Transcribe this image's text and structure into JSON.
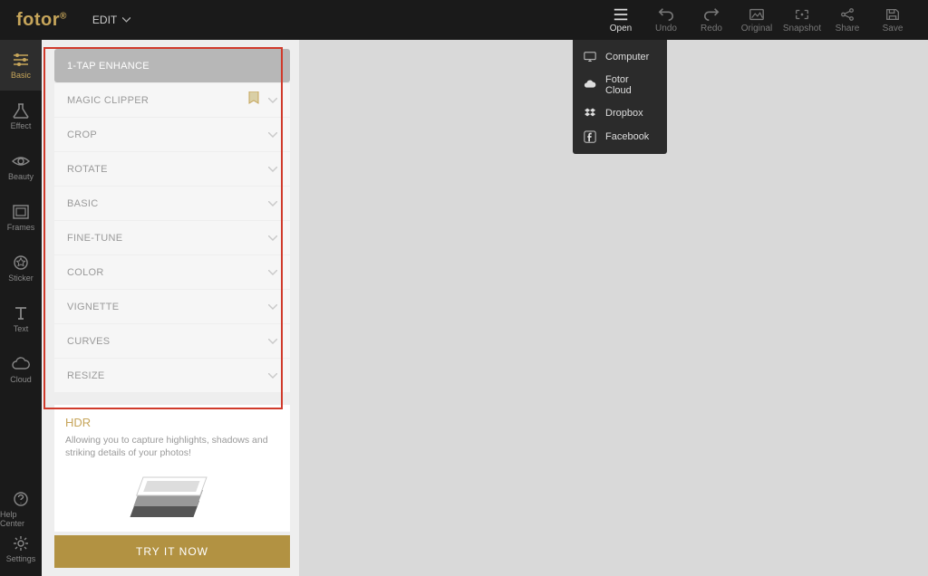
{
  "brand": "fotor",
  "brand_sup": "®",
  "edit_menu_label": "EDIT",
  "toolbar": {
    "open": "Open",
    "undo": "Undo",
    "redo": "Redo",
    "original": "Original",
    "snapshot": "Snapshot",
    "share": "Share",
    "save": "Save"
  },
  "open_menu": {
    "computer": "Computer",
    "fotor_cloud": "Fotor Cloud",
    "dropbox": "Dropbox",
    "facebook": "Facebook"
  },
  "leftnav": {
    "basic": "Basic",
    "effect": "Effect",
    "beauty": "Beauty",
    "frames": "Frames",
    "sticker": "Sticker",
    "text": "Text",
    "cloud": "Cloud",
    "help": "Help Center",
    "settings": "Settings"
  },
  "accordion": {
    "enhance": "1-TAP ENHANCE",
    "magic_clipper": "MAGIC CLIPPER",
    "crop": "CROP",
    "rotate": "ROTATE",
    "basic": "BASIC",
    "fine_tune": "FINE-TUNE",
    "color": "COLOR",
    "vignette": "VIGNETTE",
    "curves": "CURVES",
    "resize": "RESIZE"
  },
  "hdr": {
    "title": "HDR",
    "text": "Allowing you to capture highlights, shadows and striking details of your photos!",
    "try_btn": "TRY IT NOW"
  }
}
